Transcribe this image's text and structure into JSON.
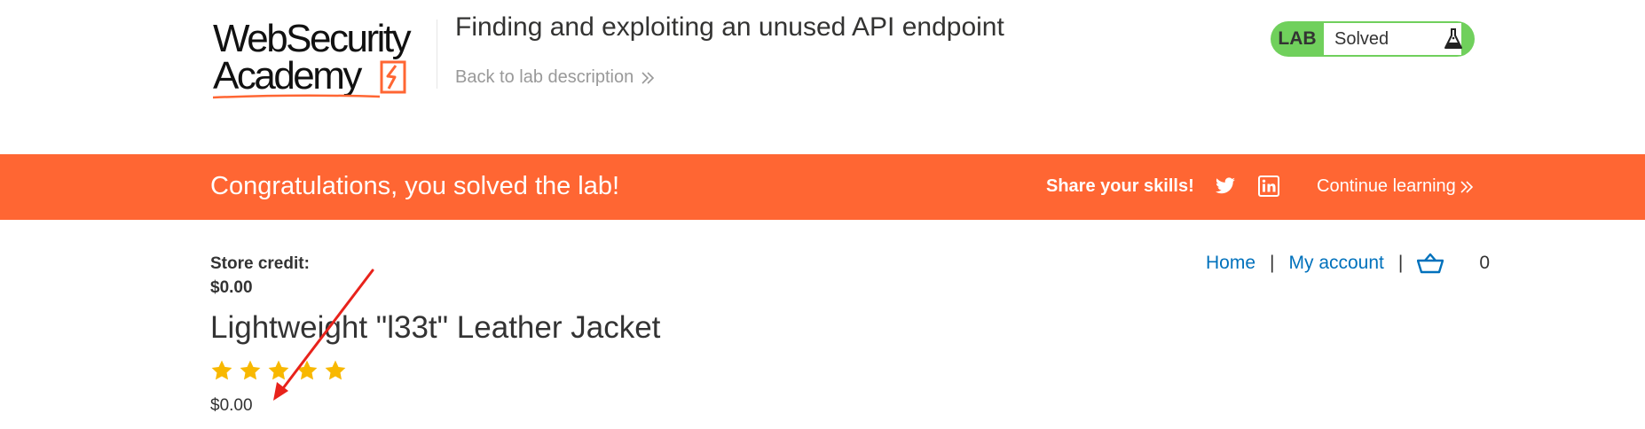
{
  "header": {
    "logo_line1": "WebSecurity",
    "logo_line2": "Academy",
    "lab_title": "Finding and exploiting an unused API endpoint",
    "back_link": "Back to lab description",
    "status_tag": "LAB",
    "status_text": "Solved"
  },
  "banner": {
    "message": "Congratulations, you solved the lab!",
    "share_label": "Share your skills!",
    "continue_label": "Continue learning"
  },
  "account": {
    "store_credit_label": "Store credit:",
    "store_credit_value": "$0.00"
  },
  "nav": {
    "home": "Home",
    "separator": "|",
    "my_account": "My account",
    "cart_count": "0"
  },
  "product": {
    "title": "Lightweight \"l33t\" Leather Jacket",
    "rating": 5,
    "rating_max": 5,
    "price": "$0.00"
  },
  "colors": {
    "banner": "#ff6633",
    "status_green": "#70d05c",
    "link_blue": "#0071bc",
    "star": "#f8b800",
    "annotation_arrow": "#e8221b"
  }
}
